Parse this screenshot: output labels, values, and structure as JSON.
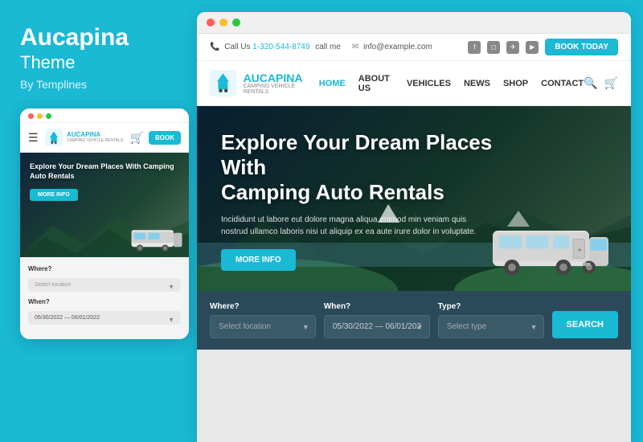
{
  "left": {
    "brand_title": "Aucapina",
    "brand_theme": "Theme",
    "brand_by": "By Templines",
    "mobile": {
      "book_btn": "BOOK",
      "logo_name": "AUCAPINA",
      "logo_sub": "CAMPING VEHICLE RENTALS",
      "hero_title": "Explore Your Dream Places With Camping Auto Rentals",
      "more_info": "MORE INFO",
      "where_label": "Where?",
      "where_placeholder": "Select location",
      "when_label": "When?",
      "when_placeholder": "05/30/2022 — 06/01/2022"
    }
  },
  "right": {
    "topbar": {
      "phone_label": "Call Us",
      "phone_number": "1-320-544-8749",
      "call_me": "call me",
      "email": "info@example.com",
      "book_btn": "BOOK TODAY"
    },
    "nav": {
      "logo_name": "AUCAPINA",
      "logo_tagline": "CAMPING VEHICLE RENTALS",
      "links": [
        {
          "label": "HOME",
          "active": true
        },
        {
          "label": "ABOUT US",
          "active": false
        },
        {
          "label": "VEHICLES",
          "active": false
        },
        {
          "label": "NEWS",
          "active": false
        },
        {
          "label": "SHOP",
          "active": false
        },
        {
          "label": "CONTACT",
          "active": false
        }
      ]
    },
    "hero": {
      "title": "Explore Your Dream Places With\nCamping Auto Rentals",
      "description": "Incididunt ut labore eut dolore magna aliqua enimod min veniam quis nostrud ullamco laboris nisi ut aliquip ex ea aute irure dolor in voluptate.",
      "more_info_btn": "MORE INFO"
    },
    "search": {
      "where_label": "Where?",
      "where_placeholder": "Select location",
      "when_label": "When?",
      "when_value": "05/30/2022 — 06/01/2022",
      "type_label": "Type?",
      "type_placeholder": "Select type",
      "search_btn": "SEARCH"
    }
  },
  "social_icons": [
    "f",
    "☁",
    "◁",
    "▶"
  ]
}
